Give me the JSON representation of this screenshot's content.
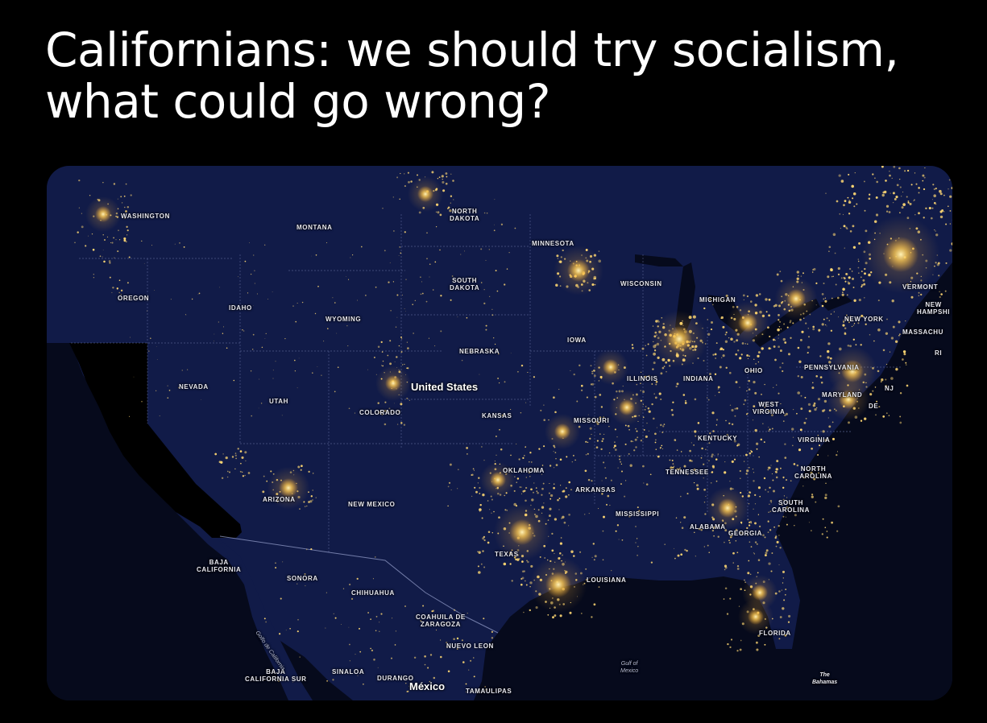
{
  "caption": "Californians: we should try socialism, what could go wrong?",
  "map": {
    "country": "United States",
    "labels": {
      "washington": "WASHINGTON",
      "montana": "MONTANA",
      "north_dakota": "NORTH\nDAKOTA",
      "minnesota": "MINNESOTA",
      "oregon": "OREGON",
      "idaho": "IDAHO",
      "wyoming": "WYOMING",
      "south_dakota": "SOUTH\nDAKOTA",
      "wisconsin": "WISCONSIN",
      "michigan": "MICHIGAN",
      "vermont": "VERMONT",
      "new_hampshire": "NEW\nHAMPSHI",
      "massachusetts": "MASSACHU",
      "ri": "RI",
      "new_york": "NEW YORK",
      "nebraska": "NEBRASKA",
      "iowa": "IOWA",
      "illinois": "ILLINOIS",
      "indiana": "INDIANA",
      "ohio": "OHIO",
      "pennsylvania": "PENNSYLVANIA",
      "nevada": "NEVADA",
      "utah": "UTAH",
      "colorado": "COLORADO",
      "kansas": "KANSAS",
      "missouri": "MISSOURI",
      "west_virginia": "WEST\nVIRGINIA",
      "maryland": "MARYLAND",
      "nj": "NJ",
      "de": "DE",
      "virginia": "VIRGINIA",
      "kentucky": "KENTUCKY",
      "oklahoma": "OKLAHOMA",
      "tennessee": "TENNESSEE",
      "north_carolina": "NORTH\nCAROLINA",
      "arkansas": "ARKANSAS",
      "arizona": "ARIZONA",
      "new_mexico": "NEW MEXICO",
      "mississippi": "MISSISSIPPI",
      "alabama": "ALABAMA",
      "georgia": "GEORGIA",
      "south_carolina": "SOUTH\nCAROLINA",
      "texas": "TEXAS",
      "louisiana": "LOUISIANA",
      "baja_california": "BAJA\nCALIFORNIA",
      "sonora": "SONORA",
      "chihuahua": "CHIHUAHUA",
      "coahuila": "COAHUILA DE\nZARAGOZA",
      "nuevo_leon": "NUEVO LEON",
      "florida": "FLORIDA",
      "baja_california_sur": "BAJA\nCALIFORNIA SUR",
      "sinaloa": "SINALOA",
      "durango": "DURANGO",
      "mexico": "México",
      "tamaulipas": "TAMAULIPAS",
      "gulf_of_california": "Golfo de California",
      "gulf_of_mexico": "Gulf of\nMexico",
      "bahamas": "The\nBahamas"
    },
    "colors": {
      "land": "#101a45",
      "ocean": "#060a1c",
      "city_lights": "#ffd873",
      "california": "#000000",
      "borders": "#8a95c8"
    }
  }
}
